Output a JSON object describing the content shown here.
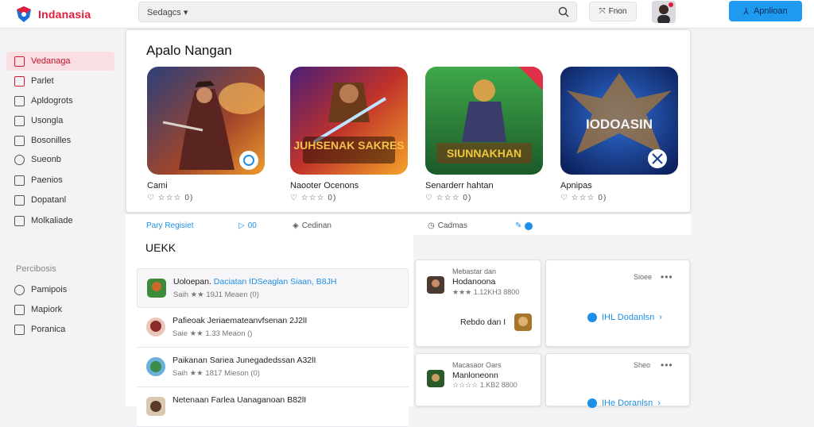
{
  "brand": {
    "name": "Indanasia",
    "color": "#e01c3a"
  },
  "search": {
    "value": "Sedagcs ▾"
  },
  "topbar": {
    "button_label": "Fnon",
    "cta_label": "Apnlioan"
  },
  "sidebar": {
    "items": [
      {
        "label": "Vedanaga",
        "icon": "home-icon"
      },
      {
        "label": "Parlet",
        "icon": "grid-icon"
      },
      {
        "label": "Apldogrots",
        "icon": "apps-icon"
      },
      {
        "label": "Usongla",
        "icon": "check-icon"
      },
      {
        "label": "Bosonilles",
        "icon": "doc-icon"
      },
      {
        "label": "Sueonb",
        "icon": "search-icon"
      },
      {
        "label": "Paenios",
        "icon": "layers-icon"
      },
      {
        "label": "Dopatanl",
        "icon": "bookmark-icon"
      },
      {
        "label": "Molkaliade",
        "icon": "store-icon"
      }
    ],
    "section_heading": "Percibosis",
    "section_items": [
      {
        "label": "Pamipois",
        "icon": "chat-icon"
      },
      {
        "label": "Mapiork",
        "icon": "map-icon"
      },
      {
        "label": "Poranica",
        "icon": "box-icon"
      }
    ]
  },
  "featured": {
    "title": "Apalo Nangan",
    "games": [
      {
        "name": "Cami",
        "rating": "♡ ☆☆☆ 0)",
        "art_text": ""
      },
      {
        "name": "Naooter Ocenons",
        "rating": "♡ ☆☆☆ 0)",
        "art_text": "JUHSENAK SAKRES"
      },
      {
        "name": "Senarderr hahtan",
        "rating": "♡ ☆☆☆ 0)",
        "art_text": "SIUNNAKHAN"
      },
      {
        "name": "Apnipas",
        "rating": "♡ ☆☆☆ 0)",
        "art_text": "IODOASIN"
      }
    ]
  },
  "subrow": {
    "link1": "Pary Regisiet",
    "link2": "00",
    "link3": "Cedinan",
    "link4": "Cadmas"
  },
  "list": {
    "title": "UEKK",
    "items": [
      {
        "title_a": "Uoloepan. ",
        "title_b": "Daciatan IDSeaglan Siaan, B8JH",
        "meta": "Saih ★★ 19J1 Meaen (0)"
      },
      {
        "title_a": "Pafieoak Jeriaemateanvfsenan 2J2lI",
        "title_b": "",
        "meta": "Saie ★★ 1.33 Meaon ()"
      },
      {
        "title_a": "Paikanan Sariea Junegadedssan A32lI",
        "title_b": "",
        "meta": "Saih ★★ 1817 Mieson (0)"
      },
      {
        "title_a": "Netenaan Farlea Uanaganoan B82lI",
        "title_b": "",
        "meta": ""
      }
    ]
  },
  "cards": [
    {
      "small": "Mebastar dan",
      "name": "Hodanoona",
      "meta": "★★★ 1.12KH3 8800",
      "footer": "Rebdo dan I"
    },
    {
      "small": "Sioee",
      "link": "IHL Dodanlsn"
    },
    {
      "small": "Macasaor Oars",
      "name": "Manloneonn",
      "meta": "☆☆☆☆ 1.KB2 8800"
    },
    {
      "small": "Sheo",
      "link": "IHe Doranlsn"
    }
  ]
}
